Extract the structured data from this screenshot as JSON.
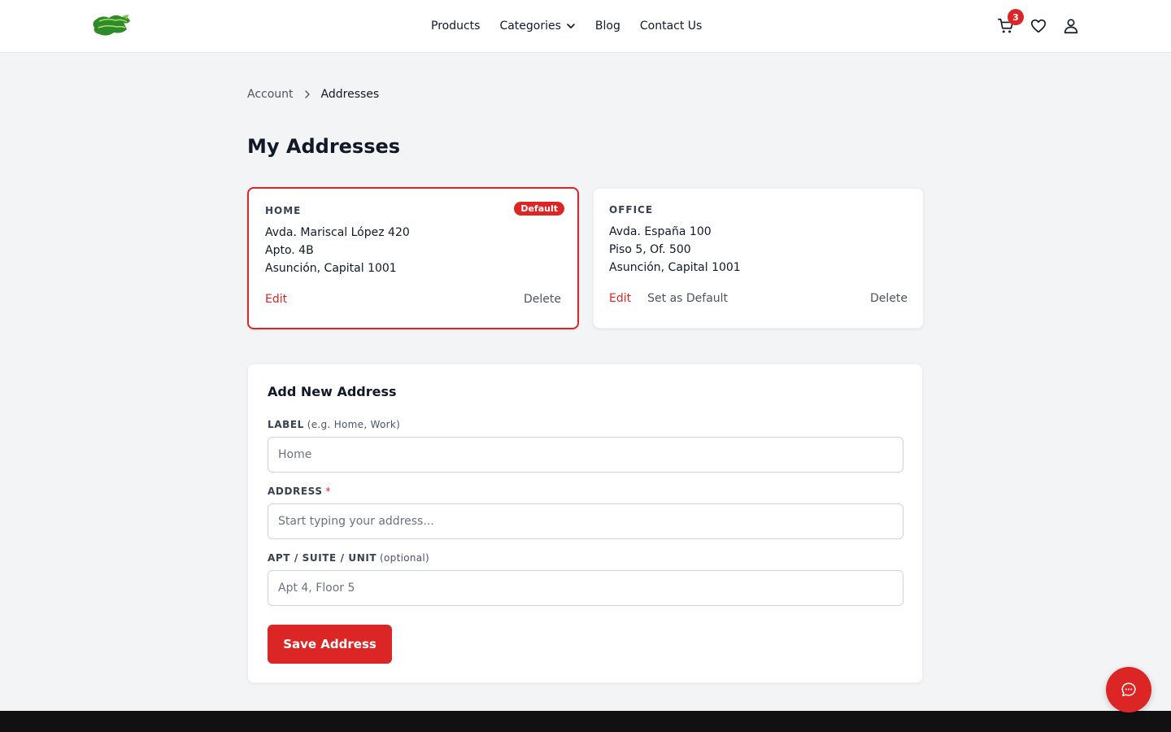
{
  "header": {
    "logo_icon": "verde-ruta-logo",
    "nav": [
      {
        "label": "Products"
      },
      {
        "label": "Categories"
      },
      {
        "label": "Blog"
      },
      {
        "label": "Contact Us"
      }
    ],
    "cart_count": "3"
  },
  "breadcrumb": {
    "parent": "Account",
    "current": "Addresses"
  },
  "page": {
    "title": "My Addresses"
  },
  "addresses": [
    {
      "label": "HOME",
      "badge": "Default",
      "line1": "Avda. Mariscal López 420",
      "line2": "Apto. 4B",
      "line3": "Asunción, Capital 1001",
      "edit_label": "Edit",
      "delete_label": "Delete"
    },
    {
      "label": "OFFICE",
      "line1": "Avda. España 100",
      "line2": "Piso 5, Of. 500",
      "line3": "Asunción, Capital 1001",
      "edit_label": "Edit",
      "set_default_label": "Set as Default",
      "delete_label": "Delete"
    }
  ],
  "form": {
    "title": "Add New Address",
    "label_field": {
      "label": "LABEL",
      "hint": "(e.g. Home, Work)",
      "placeholder": "Home"
    },
    "address_field": {
      "label": "ADDRESS",
      "required_mark": "*",
      "placeholder": "Start typing your address..."
    },
    "unit_field": {
      "label": "APT / SUITE / UNIT",
      "hint": "(optional)",
      "placeholder": "Apt 4, Floor 5"
    },
    "save_label": "Save Address"
  },
  "colors": {
    "accent": "#dc2626",
    "background": "#f3f4f6",
    "footer": "#111111"
  }
}
